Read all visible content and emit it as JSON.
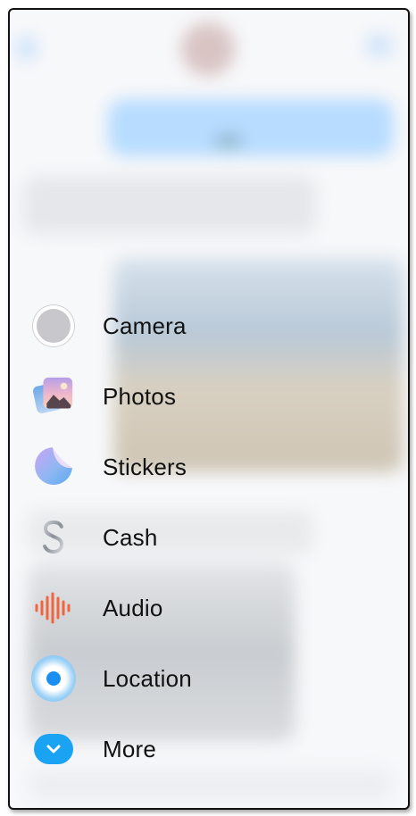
{
  "menu": {
    "items": [
      {
        "label": "Camera",
        "icon": "camera-icon"
      },
      {
        "label": "Photos",
        "icon": "photos-icon"
      },
      {
        "label": "Stickers",
        "icon": "stickers-icon"
      },
      {
        "label": "Cash",
        "icon": "cash-icon"
      },
      {
        "label": "Audio",
        "icon": "audio-icon"
      },
      {
        "label": "Location",
        "icon": "location-icon"
      },
      {
        "label": "More",
        "icon": "more-icon"
      }
    ]
  },
  "colors": {
    "more_accent": "#1aa3f2",
    "location_accent": "#1a8ff0",
    "audio_accent": "#f2643c",
    "blurred_bubble": "#b7dcff"
  }
}
